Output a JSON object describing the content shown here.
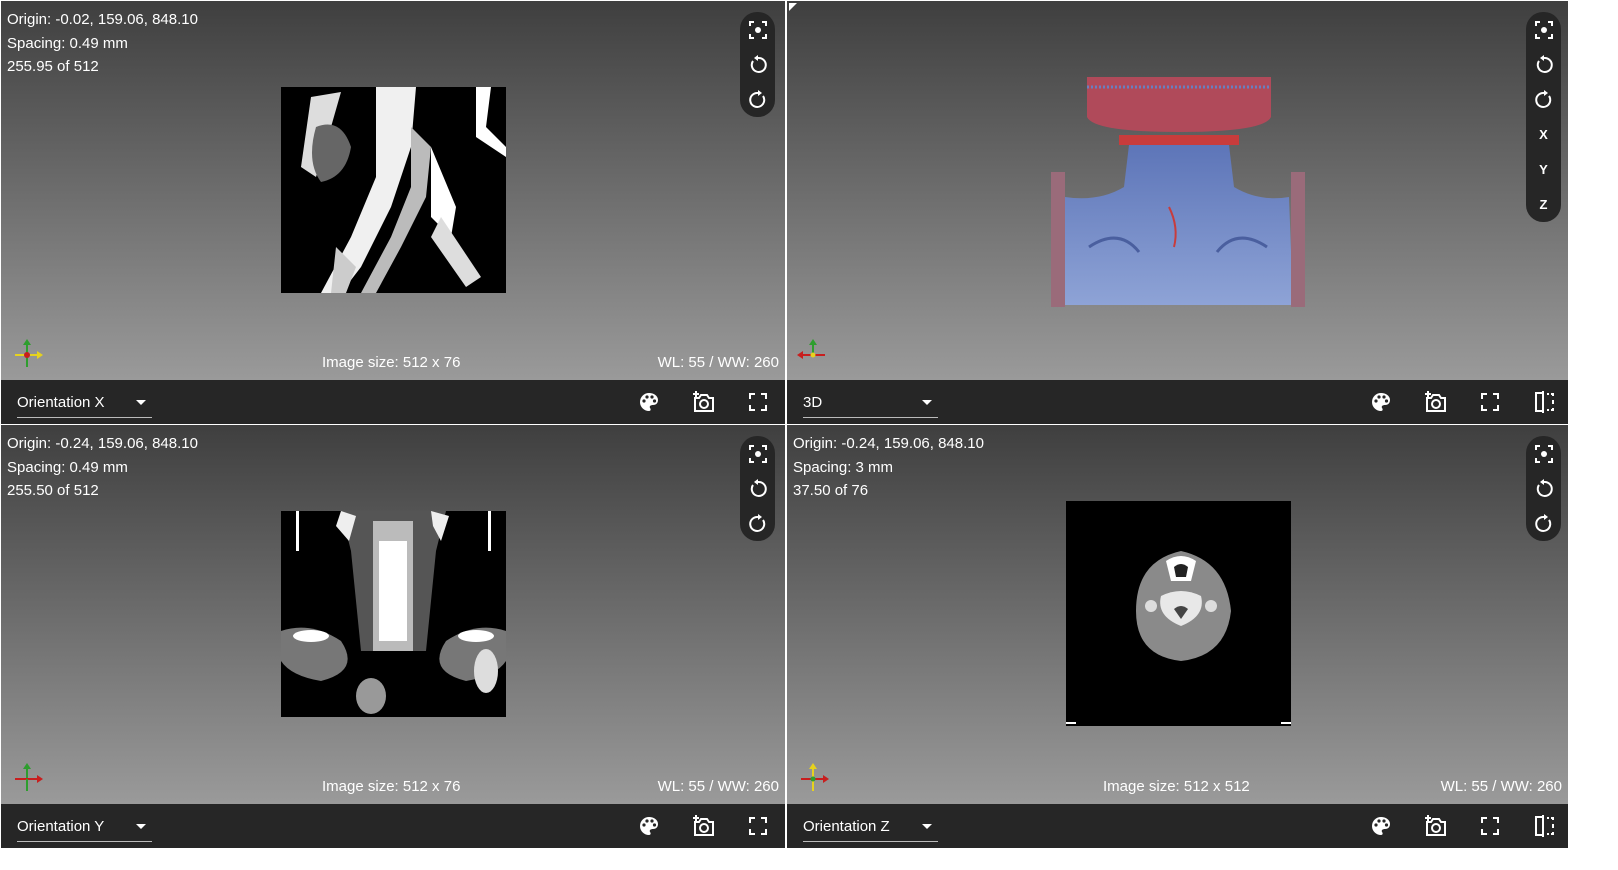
{
  "views": [
    {
      "info": [
        "Origin: -0.02, 159.06, 848.10",
        "Spacing: 0.49 mm",
        "255.95 of 512"
      ],
      "image_size": "Image size: 512 x 76",
      "wlww": "WL: 55 / WW: 260",
      "select": "Orientation X"
    },
    {
      "select": "3D",
      "axis_buttons": [
        "X",
        "Y",
        "Z"
      ]
    },
    {
      "info": [
        "Origin: -0.24, 159.06, 848.10",
        "Spacing: 0.49 mm",
        "255.50 of 512"
      ],
      "image_size": "Image size: 512 x 76",
      "wlww": "WL: 55 / WW: 260",
      "select": "Orientation Y"
    },
    {
      "info": [
        "Origin: -0.24, 159.06, 848.10",
        "Spacing: 3 mm",
        "37.50 of 76"
      ],
      "image_size": "Image size: 512 x 512",
      "wlww": "WL: 55 / WW: 260",
      "select": "Orientation Z"
    }
  ],
  "icons": {
    "view_tools": [
      "focus-icon",
      "rotate-left-icon",
      "rotate-right-icon"
    ],
    "toolbar": [
      "palette-icon",
      "camera-icon",
      "fullscreen-icon",
      "split-view-icon"
    ]
  },
  "colors": {
    "toolbar_bg": "#262626",
    "axis_x": "#c81e1e",
    "axis_y": "#2e9e2e",
    "axis_z": "#e6d21e",
    "mesh_blue": "#7890c8",
    "mesh_red": "#c83c3c"
  }
}
